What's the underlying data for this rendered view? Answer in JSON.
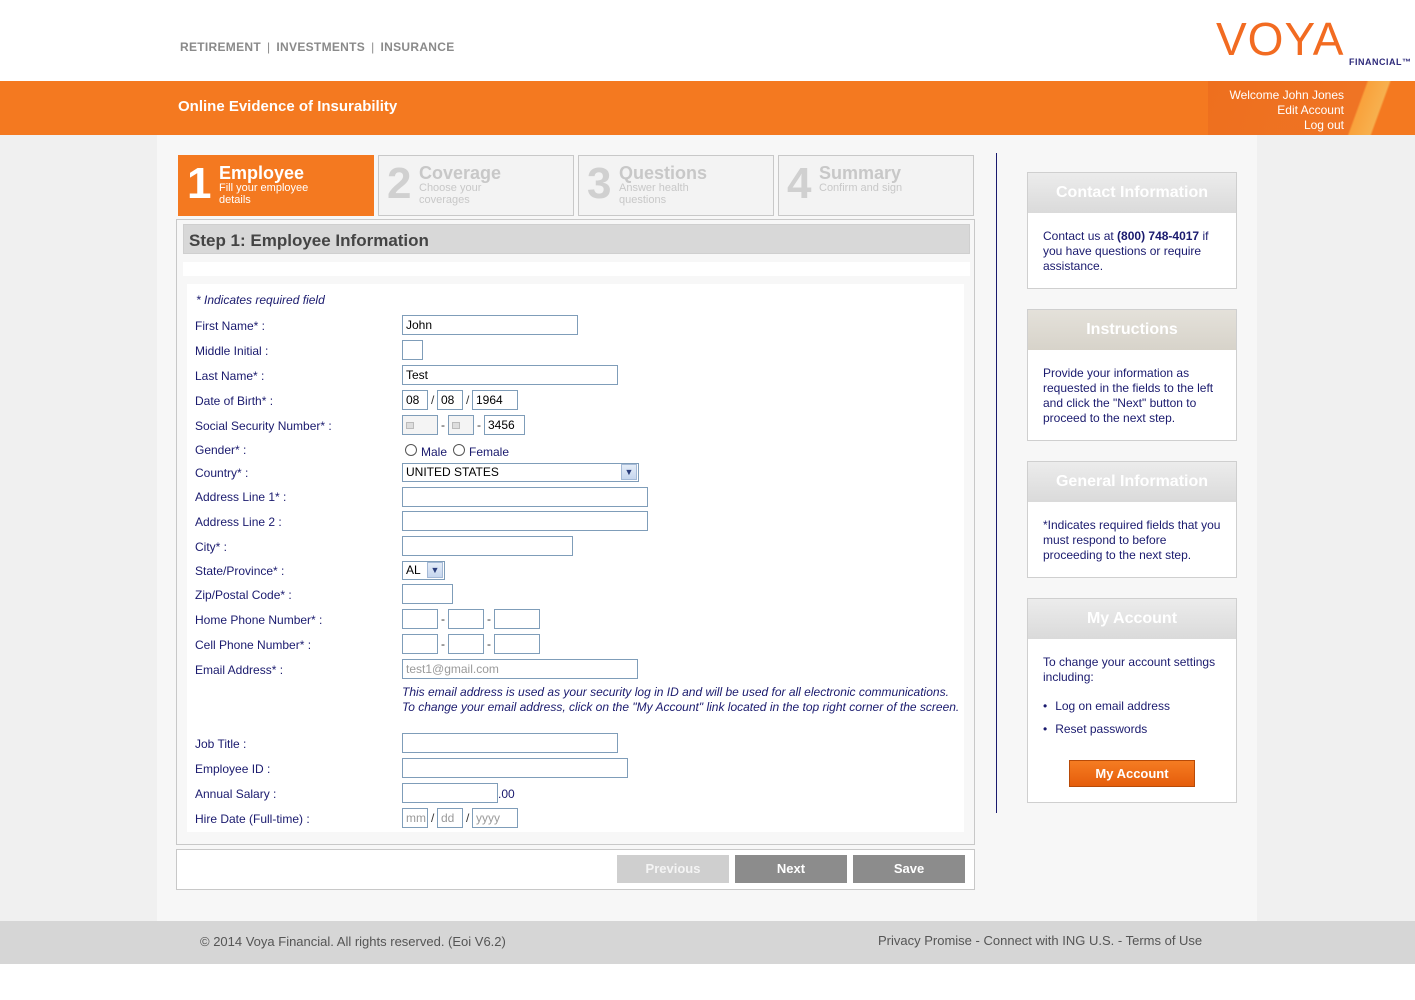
{
  "header": {
    "nav": [
      "RETIREMENT",
      "INVESTMENTS",
      "INSURANCE"
    ],
    "logo_main": "VOYA",
    "logo_sub": "FINANCIAL™"
  },
  "band": {
    "title": "Online Evidence of Insurability",
    "welcome": "Welcome John Jones",
    "edit_account": "Edit Account",
    "logout": "Log out"
  },
  "steps": [
    {
      "num": "1",
      "name": "Employee",
      "desc": "Fill your employee details",
      "active": true
    },
    {
      "num": "2",
      "name": "Coverage",
      "desc": "Choose your coverages",
      "active": false
    },
    {
      "num": "3",
      "name": "Questions",
      "desc": "Answer health questions",
      "active": false
    },
    {
      "num": "4",
      "name": "Summary",
      "desc": "Confirm and sign",
      "active": false
    }
  ],
  "form": {
    "heading": "Step 1: Employee Information",
    "required_note": "* Indicates required field",
    "labels": {
      "first_name": "First Name* :",
      "middle_initial": "Middle Initial :",
      "last_name": "Last Name* :",
      "dob": "Date of Birth* :",
      "ssn": "Social Security Number* :",
      "gender": "Gender* :",
      "country": "Country* :",
      "address1": "Address Line 1* :",
      "address2": "Address Line 2 :",
      "city": "City* :",
      "state": "State/Province* :",
      "zip": "Zip/Postal Code* :",
      "home_phone": "Home Phone Number* :",
      "cell_phone": "Cell Phone Number* :",
      "email": "Email Address* :",
      "job_title": "Job Title :",
      "employee_id": "Employee ID :",
      "salary": "Annual Salary :",
      "hire_date": "Hire Date (Full-time) :"
    },
    "values": {
      "first_name": "John",
      "middle_initial": "",
      "last_name": "Test",
      "dob_month": "08",
      "dob_day": "08",
      "dob_year": "1964",
      "ssn_last4": "3456",
      "country": "UNITED STATES",
      "state": "AL",
      "salary_suffix": ".00"
    },
    "placeholders": {
      "email": "test1@gmail.com",
      "hire_mm": "mm",
      "hire_dd": "dd",
      "hire_yyyy": "yyyy"
    },
    "gender_options": [
      "Male",
      "Female"
    ],
    "email_note": "This email address is used as your security log in ID and will be used for all electronic communications. To change your email address, click on the \"My Account\" link located in the top right corner of the screen."
  },
  "buttons": {
    "previous": "Previous",
    "next": "Next",
    "save": "Save"
  },
  "sidebar": {
    "contact": {
      "title": "Contact Information",
      "pre": "Contact us at ",
      "phone": "(800) 748-4017",
      "post": " if you have questions or require assistance."
    },
    "instructions": {
      "title": "Instructions",
      "body": "Provide your information as requested in the fields to the left and click the \"Next\" button to proceed to the next step."
    },
    "general": {
      "title": "General Information",
      "body": "*Indicates required fields that you must respond to before proceeding to the next step."
    },
    "account": {
      "title": "My Account",
      "body": "To change your account settings including:",
      "items": [
        "Log on email address",
        "Reset passwords"
      ],
      "button": "My Account"
    }
  },
  "footer": {
    "copyright": "© 2014 Voya Financial. All rights reserved. (Eoi V6.2)",
    "privacy": "Privacy Promise",
    "connect": "Connect with ING U.S.",
    "terms": "Terms of Use",
    "sep": " - "
  },
  "colors": {
    "brand_orange": "#f47920",
    "text_navy": "#1a1a6e"
  }
}
